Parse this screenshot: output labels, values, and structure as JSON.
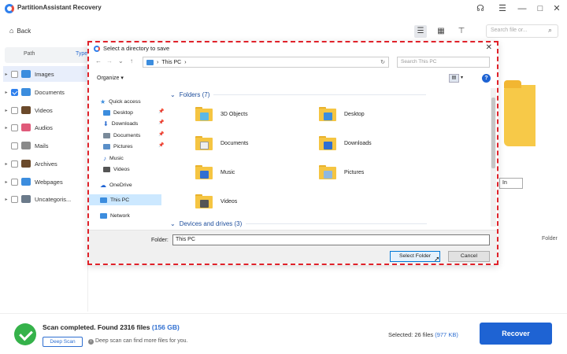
{
  "app": {
    "title": "PartitionAssistant Recovery",
    "back_label": "Back",
    "search_placeholder": "Search file or..."
  },
  "window_controls": {
    "headset": "☊",
    "menu": "☰",
    "minimize": "—",
    "maximize": "□",
    "close": "✕"
  },
  "sidebar": {
    "tabs": [
      "Path",
      "Type"
    ],
    "items": [
      {
        "label": "Images",
        "checked": false,
        "color": "#3c8dde"
      },
      {
        "label": "Documents",
        "checked": true,
        "color": "#3c8dde"
      },
      {
        "label": "Videos",
        "checked": false,
        "color": "#6b4a2b"
      },
      {
        "label": "Audios",
        "checked": false,
        "color": "#e05a7a"
      },
      {
        "label": "Mails",
        "checked": false,
        "color": "#8a8a8a"
      },
      {
        "label": "Archives",
        "checked": false,
        "color": "#6b4a2b"
      },
      {
        "label": "Webpages",
        "checked": false,
        "color": "#3c8dde"
      },
      {
        "label": "Uncategoris...",
        "checked": false,
        "color": "#6b7a8a"
      }
    ]
  },
  "right_panel": {
    "field_value": "In",
    "folder_label": "Folder"
  },
  "dialog": {
    "title": "Select a directory to save",
    "address": "This PC",
    "search_placeholder": "Search This PC",
    "organize": "Organize",
    "nav": {
      "quick_access": "Quick access",
      "quick_items": [
        "Desktop",
        "Downloads",
        "Documents",
        "Pictures",
        "Music",
        "Videos"
      ],
      "onedrive": "OneDrive",
      "this_pc": "This PC",
      "network": "Network"
    },
    "folders_header": "Folders (7)",
    "folders": [
      "3D Objects",
      "Desktop",
      "Documents",
      "Downloads",
      "Music",
      "Pictures",
      "Videos"
    ],
    "devices_header": "Devices and drives (3)",
    "folder_label": "Folder:",
    "folder_value": "This PC",
    "select_button": "Select Folder",
    "cancel_button": "Cancel"
  },
  "bottom": {
    "scan_status": "Scan completed. Found 2316 files",
    "scan_size": "(156 GB)",
    "deep_scan": "Deep Scan",
    "deep_note": "Deep scan can find more files for you.",
    "selected_prefix": "Selected: 26 files",
    "selected_size": "(977 KB)",
    "recover": "Recover"
  }
}
